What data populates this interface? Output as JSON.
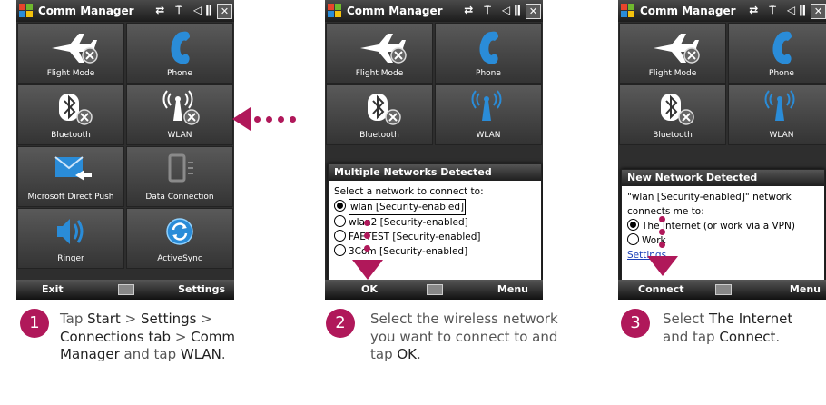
{
  "colors": {
    "accent": "#b0185a",
    "phone_blue": "#2a8cd8",
    "tile": "#4a4a4a"
  },
  "screen1": {
    "title": "Comm Manager",
    "status_icons": "⇄ ⍑ ◁ǁ",
    "tiles": [
      {
        "label": "Flight Mode",
        "icon": "airplane-icon"
      },
      {
        "label": "Phone",
        "icon": "phone-icon"
      },
      {
        "label": "Bluetooth",
        "icon": "bluetooth-icon"
      },
      {
        "label": "WLAN",
        "icon": "wlan-icon"
      },
      {
        "label": "Microsoft Direct Push",
        "icon": "envelope-icon"
      },
      {
        "label": "Data Connection",
        "icon": "data-connection-icon"
      },
      {
        "label": "Ringer",
        "icon": "speaker-icon"
      },
      {
        "label": "ActiveSync",
        "icon": "activesync-icon"
      }
    ],
    "softkey_left": "Exit",
    "softkey_right": "Settings"
  },
  "screen2": {
    "title": "Comm Manager",
    "tiles": [
      {
        "label": "Flight Mode"
      },
      {
        "label": "Phone"
      },
      {
        "label": "Bluetooth"
      },
      {
        "label": "WLAN"
      }
    ],
    "dialog_title": "Multiple Networks Detected",
    "prompt": "Select a network to connect to:",
    "networks": [
      "wlan [Security-enabled]",
      "wlan2 [Security-enabled]",
      "FAETEST [Security-enabled]",
      "3Com [Security-enabled]"
    ],
    "softkey_left": "OK",
    "softkey_right": "Menu"
  },
  "screen3": {
    "title": "Comm Manager",
    "tiles": [
      {
        "label": "Flight Mode"
      },
      {
        "label": "Phone"
      },
      {
        "label": "Bluetooth"
      },
      {
        "label": "WLAN"
      }
    ],
    "dialog_title": "New Network Detected",
    "message": "\"wlan [Security-enabled]\" network connects me to:",
    "options": [
      "The Internet (or work via a VPN)",
      "Work"
    ],
    "settings_link": "Settings",
    "softkey_left": "Connect",
    "softkey_right": "Menu"
  },
  "steps": [
    {
      "number": "1",
      "parts": [
        "Tap ",
        "Start",
        " > ",
        "Settings",
        " > ",
        "Connections tab",
        " > ",
        "Comm Manager",
        " and tap ",
        "WLAN",
        "."
      ]
    },
    {
      "number": "2",
      "parts": [
        "Select the wireless network you want to connect to and tap ",
        "OK",
        "."
      ]
    },
    {
      "number": "3",
      "parts": [
        "Select ",
        "The Internet",
        " and tap ",
        "Connect",
        "."
      ]
    }
  ]
}
